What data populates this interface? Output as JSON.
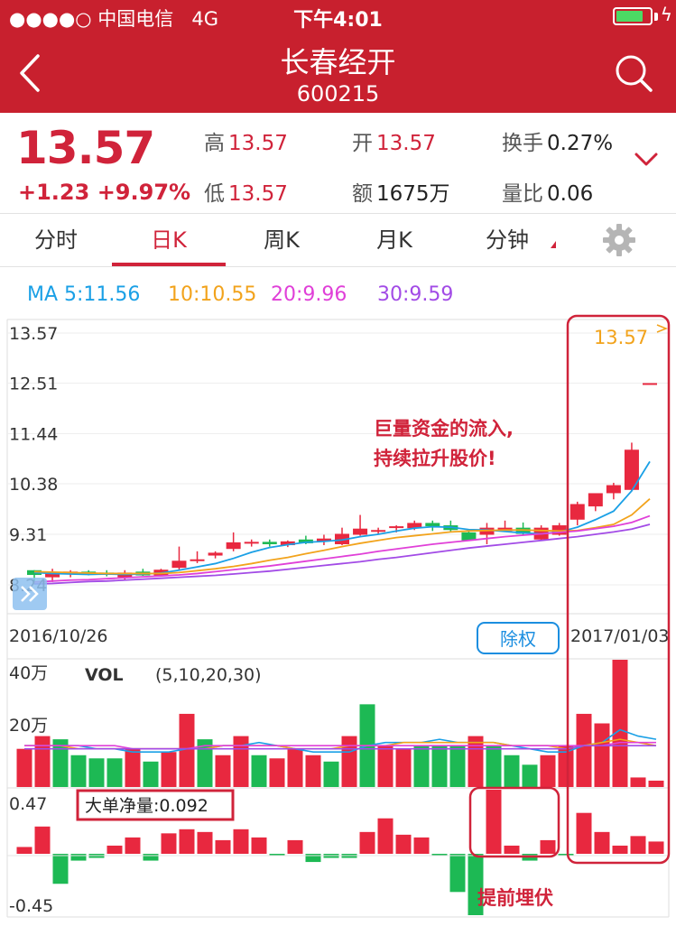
{
  "status": {
    "carrier": "●●●●○ 中国电信",
    "network": "4G",
    "time": "下午4:01",
    "battery_pct": 80
  },
  "header": {
    "title": "长春经开",
    "code": "600215"
  },
  "quote": {
    "price": "13.57",
    "change": "+1.23",
    "change_pct": "+9.97%",
    "high_label": "高",
    "high": "13.57",
    "open_label": "开",
    "open": "13.57",
    "turnover_label": "换手",
    "turnover": "0.27%",
    "low_label": "低",
    "low": "13.57",
    "amount_label": "额",
    "amount": "1675万",
    "volratio_label": "量比",
    "volratio": "0.06"
  },
  "tabs": [
    {
      "label": "分时",
      "active": false
    },
    {
      "label": "日K",
      "active": true
    },
    {
      "label": "周K",
      "active": false
    },
    {
      "label": "月K",
      "active": false
    },
    {
      "label": "分钟",
      "active": false
    }
  ],
  "ma_legend": [
    {
      "label": "MA 5:11.56",
      "color": "#1aa0e6"
    },
    {
      "label": "10:10.55",
      "color": "#f2a31c"
    },
    {
      "label": "20:9.96",
      "color": "#e040d8"
    },
    {
      "label": "30:9.59",
      "color": "#a24be6"
    }
  ],
  "chart_data": [
    {
      "type": "candlestick",
      "y_ticks": [
        "13.57",
        "12.51",
        "11.44",
        "10.38",
        "9.31",
        "8.24"
      ],
      "ylim": [
        8.24,
        13.57
      ],
      "x_start_label": "2016/10/26",
      "x_end_label": "2017/01/03",
      "last_price_label": "13.57",
      "ohlc": [
        [
          8.55,
          8.55,
          8.3,
          8.45
        ],
        [
          8.4,
          8.58,
          8.3,
          8.5
        ],
        [
          8.48,
          8.55,
          8.4,
          8.52
        ],
        [
          8.52,
          8.55,
          8.44,
          8.45
        ],
        [
          8.5,
          8.55,
          8.42,
          8.45
        ],
        [
          8.4,
          8.55,
          8.35,
          8.5
        ],
        [
          8.52,
          8.58,
          8.43,
          8.44
        ],
        [
          8.44,
          8.58,
          8.42,
          8.56
        ],
        [
          8.6,
          9.05,
          8.55,
          8.75
        ],
        [
          8.76,
          8.95,
          8.7,
          8.78
        ],
        [
          8.86,
          8.95,
          8.8,
          8.92
        ],
        [
          9.0,
          9.35,
          8.95,
          9.14
        ],
        [
          9.12,
          9.2,
          9.05,
          9.15
        ],
        [
          9.15,
          9.2,
          9.05,
          9.1
        ],
        [
          9.08,
          9.18,
          9.04,
          9.16
        ],
        [
          9.2,
          9.28,
          9.1,
          9.12
        ],
        [
          9.16,
          9.3,
          9.08,
          9.22
        ],
        [
          9.1,
          9.45,
          9.08,
          9.32
        ],
        [
          9.3,
          9.72,
          9.28,
          9.43
        ],
        [
          9.4,
          9.45,
          9.3,
          9.4
        ],
        [
          9.45,
          9.5,
          9.35,
          9.48
        ],
        [
          9.44,
          9.6,
          9.4,
          9.55
        ],
        [
          9.55,
          9.6,
          9.38,
          9.48
        ],
        [
          9.5,
          9.6,
          9.36,
          9.4
        ],
        [
          9.35,
          9.4,
          9.18,
          9.18
        ],
        [
          9.3,
          9.55,
          9.1,
          9.45
        ],
        [
          9.38,
          9.6,
          9.36,
          9.45
        ],
        [
          9.45,
          9.56,
          9.28,
          9.32
        ],
        [
          9.2,
          9.5,
          9.18,
          9.45
        ],
        [
          9.3,
          9.55,
          9.28,
          9.5
        ],
        [
          9.62,
          10.0,
          9.5,
          9.95
        ],
        [
          9.9,
          10.1,
          9.8,
          10.18
        ],
        [
          10.18,
          10.4,
          10.05,
          10.35
        ],
        [
          10.25,
          11.25,
          10.22,
          11.1
        ],
        [
          12.51,
          12.51,
          12.51,
          12.51
        ]
      ],
      "ma5": [
        8.5,
        8.48,
        8.47,
        8.46,
        8.47,
        8.46,
        8.47,
        8.49,
        8.55,
        8.62,
        8.69,
        8.8,
        8.93,
        9.03,
        9.09,
        9.14,
        9.16,
        9.19,
        9.26,
        9.31,
        9.38,
        9.44,
        9.47,
        9.46,
        9.41,
        9.4,
        9.37,
        9.34,
        9.32,
        9.36,
        9.46,
        9.62,
        9.8,
        10.23,
        10.85
      ],
      "ma10": [
        8.52,
        8.51,
        8.5,
        8.49,
        8.48,
        8.48,
        8.48,
        8.48,
        8.5,
        8.54,
        8.58,
        8.63,
        8.69,
        8.76,
        8.82,
        8.9,
        8.97,
        9.05,
        9.12,
        9.18,
        9.24,
        9.28,
        9.32,
        9.36,
        9.38,
        9.39,
        9.4,
        9.4,
        9.39,
        9.38,
        9.39,
        9.45,
        9.52,
        9.72,
        10.06
      ],
      "ma20": [
        8.3,
        8.32,
        8.34,
        8.35,
        8.37,
        8.39,
        8.41,
        8.43,
        8.45,
        8.48,
        8.52,
        8.56,
        8.6,
        8.64,
        8.69,
        8.74,
        8.79,
        8.84,
        8.89,
        8.95,
        9.0,
        9.05,
        9.1,
        9.14,
        9.18,
        9.22,
        9.26,
        9.29,
        9.32,
        9.35,
        9.38,
        9.43,
        9.48,
        9.56,
        9.7
      ],
      "ma30": [
        8.26,
        8.27,
        8.29,
        8.31,
        8.32,
        8.34,
        8.36,
        8.38,
        8.4,
        8.42,
        8.44,
        8.47,
        8.5,
        8.53,
        8.57,
        8.61,
        8.65,
        8.69,
        8.73,
        8.78,
        8.82,
        8.87,
        8.92,
        8.97,
        9.02,
        9.06,
        9.1,
        9.14,
        9.18,
        9.22,
        9.26,
        9.31,
        9.36,
        9.42,
        9.52
      ]
    },
    {
      "type": "bar",
      "title": "VOL",
      "params": "(5,10,20,30)",
      "y_ticks": [
        "40万",
        "20万"
      ],
      "ylim": [
        0,
        40
      ],
      "values": [
        12,
        16,
        15,
        10,
        9,
        9,
        12,
        8,
        11,
        23,
        15,
        10,
        16,
        10,
        9,
        12,
        10,
        8,
        16,
        26,
        13,
        12,
        13,
        13,
        13,
        16,
        13,
        10,
        7,
        10,
        13,
        23,
        20,
        40,
        3,
        2
      ],
      "colors": [
        "up",
        "up",
        "down",
        "down",
        "down",
        "down",
        "up",
        "down",
        "up",
        "up",
        "down",
        "up",
        "up",
        "down",
        "up",
        "up",
        "up",
        "down",
        "up",
        "down",
        "up",
        "up",
        "down",
        "down",
        "down",
        "up",
        "down",
        "down",
        "down",
        "up",
        "up",
        "up",
        "up",
        "up",
        "up",
        "up"
      ],
      "ma5": [
        13,
        13,
        13,
        13,
        12,
        12,
        11,
        11,
        11,
        12,
        12,
        13,
        13,
        14,
        13,
        12,
        11,
        11,
        11,
        13,
        14,
        14,
        14,
        15,
        14,
        14,
        14,
        13,
        12,
        11,
        11,
        13,
        14,
        18,
        16,
        15
      ],
      "ma10": [
        13,
        13,
        13,
        12,
        12,
        12,
        12,
        12,
        12,
        12,
        12,
        13,
        13,
        13,
        13,
        12,
        12,
        12,
        13,
        13,
        13,
        14,
        14,
        14,
        14,
        14,
        14,
        13,
        13,
        13,
        12,
        13,
        14,
        15,
        14,
        13
      ],
      "ma20": [
        13,
        13,
        13,
        13,
        13,
        13,
        12,
        12,
        12,
        12,
        13,
        13,
        13,
        13,
        13,
        13,
        13,
        13,
        13,
        13,
        13,
        13,
        13,
        13,
        13,
        13,
        13,
        13,
        13,
        13,
        13,
        13,
        13,
        14,
        14,
        14
      ],
      "ma30": [
        12,
        12,
        12,
        12,
        12,
        12,
        12,
        12,
        12,
        12,
        12,
        12,
        12,
        12,
        12,
        12,
        12,
        12,
        12,
        12,
        12,
        12,
        12,
        12,
        12,
        12,
        12,
        12,
        12,
        12,
        12,
        13,
        13,
        13,
        13,
        13
      ]
    },
    {
      "type": "bar",
      "title": "大单净量:0.092",
      "y_ticks": [
        "0.47",
        "-0.45"
      ],
      "ylim": [
        -0.45,
        0.47
      ],
      "values": [
        0.05,
        0.2,
        -0.22,
        -0.05,
        -0.03,
        0.06,
        0.12,
        -0.05,
        0.15,
        0.18,
        0.16,
        0.1,
        0.18,
        0.12,
        -0.01,
        0.1,
        -0.06,
        -0.03,
        -0.03,
        0.16,
        0.26,
        0.14,
        0.12,
        -0.01,
        -0.28,
        -0.45,
        0.47,
        0.06,
        -0.05,
        0.1,
        -0.01,
        0.3,
        0.16,
        0.06,
        0.13,
        0.09
      ]
    }
  ],
  "annotations": {
    "buy_flow_line1": "巨量资金的流入,",
    "buy_flow_line2": "持续拉升股价!",
    "ambush": "提前埋伏",
    "restore_button": "除权"
  }
}
